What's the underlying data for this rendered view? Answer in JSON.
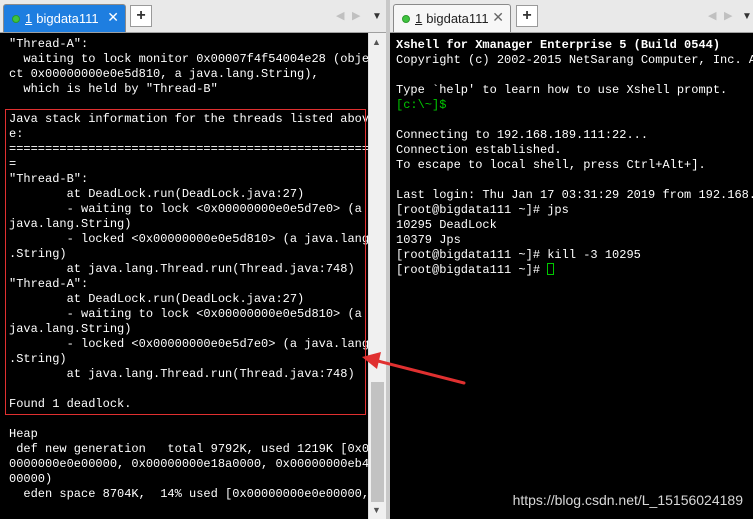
{
  "left_tab": {
    "number": "1",
    "label": "bigdata111",
    "close": "✕"
  },
  "right_tab": {
    "number": "1",
    "label": "bigdata111",
    "close": "✕"
  },
  "add_tab_label": "+",
  "nav": {
    "prev": "◀",
    "next": "▶",
    "menu": "▼"
  },
  "scrollbar": {
    "up": "▲",
    "down": "▼"
  },
  "left_terminal_lines": [
    "\"Thread-A\":",
    "  waiting to lock monitor 0x00007f4f54004e28 (obje",
    "ct 0x00000000e0e5d810, a java.lang.String),",
    "  which is held by \"Thread-B\"",
    "",
    "Java stack information for the threads listed abov",
    "e:",
    "==================================================",
    "=",
    "\"Thread-B\":",
    "        at DeadLock.run(DeadLock.java:27)",
    "        - waiting to lock <0x00000000e0e5d7e0> (a",
    "java.lang.String)",
    "        - locked <0x00000000e0e5d810> (a java.lang",
    ".String)",
    "        at java.lang.Thread.run(Thread.java:748)",
    "\"Thread-A\":",
    "        at DeadLock.run(DeadLock.java:27)",
    "        - waiting to lock <0x00000000e0e5d810> (a",
    "java.lang.String)",
    "        - locked <0x00000000e0e5d7e0> (a java.lang",
    ".String)",
    "        at java.lang.Thread.run(Thread.java:748)",
    "",
    "Found 1 deadlock.",
    "",
    "Heap",
    " def new generation   total 9792K, used 1219K [0x0",
    "0000000e0e00000, 0x00000000e18a0000, 0x00000000eb4",
    "00000)",
    "  eden space 8704K,  14% used [0x00000000e0e00000,"
  ],
  "right_terminal": {
    "banner": "Xshell for Xmanager Enterprise 5 (Build 0544)",
    "copyright": "Copyright (c) 2002-2015 NetSarang Computer, Inc. A",
    "help": "Type `help' to learn how to use Xshell prompt.",
    "local_prompt": "[c:\\~]$",
    "connecting": "Connecting to 192.168.189.111:22...",
    "established": "Connection established.",
    "escape": "To escape to local shell, press Ctrl+Alt+].",
    "last_login": "Last login: Thu Jan 17 03:31:29 2019 from 192.168.",
    "cmd_jps": "[root@bigdata111 ~]# jps",
    "jps_1": "10295 DeadLock",
    "jps_2": "10379 Jps",
    "cmd_kill": "[root@bigdata111 ~]# kill -3 10295",
    "prompt": "[root@bigdata111 ~]# "
  },
  "watermark": "https://blog.csdn.net/L_15156024189",
  "colors": {
    "tab_active": "#1e7ee0",
    "highlight": "#e03030",
    "prompt_green": "#00c800"
  }
}
